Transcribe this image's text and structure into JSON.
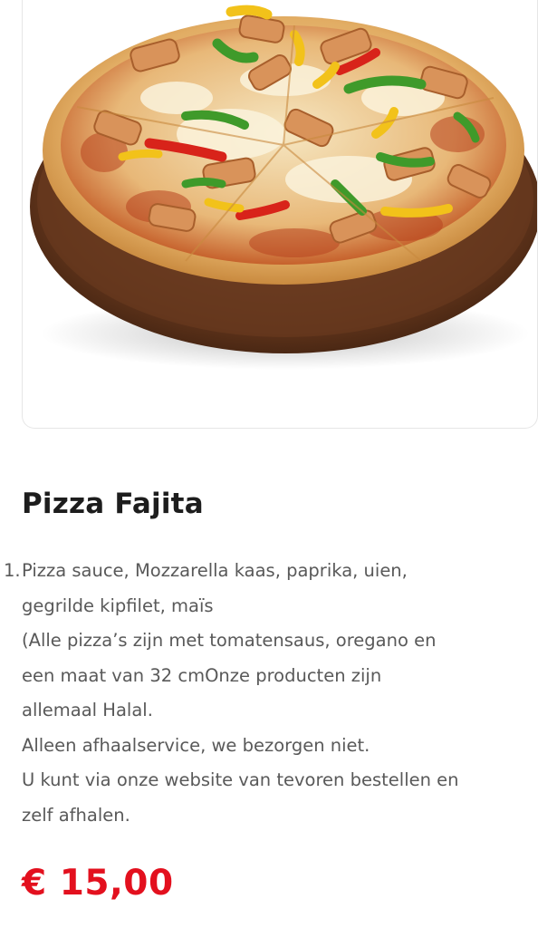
{
  "product": {
    "image_alt": "Pizza Fajita",
    "title": "Pizza Fajita",
    "list_number": "1.",
    "description_lines": [
      "Pizza sauce, Mozzarella kaas, paprika, uien,",
      "gegrilde kipfilet, maïs",
      "(Alle pizza’s zijn met tomatensaus, oregano en",
      "een maat van 32 cmOnze producten zijn",
      "allemaal Halal.",
      "Alleen afhaalservice, we bezorgen niet.",
      "U kunt via onze website van tevoren bestellen en",
      "zelf afhalen."
    ],
    "price": "€ 15,00"
  },
  "colors": {
    "price": "#e3101e",
    "title": "#1d1d1d",
    "body_text": "#595959",
    "card_border": "#e6e6e6"
  }
}
